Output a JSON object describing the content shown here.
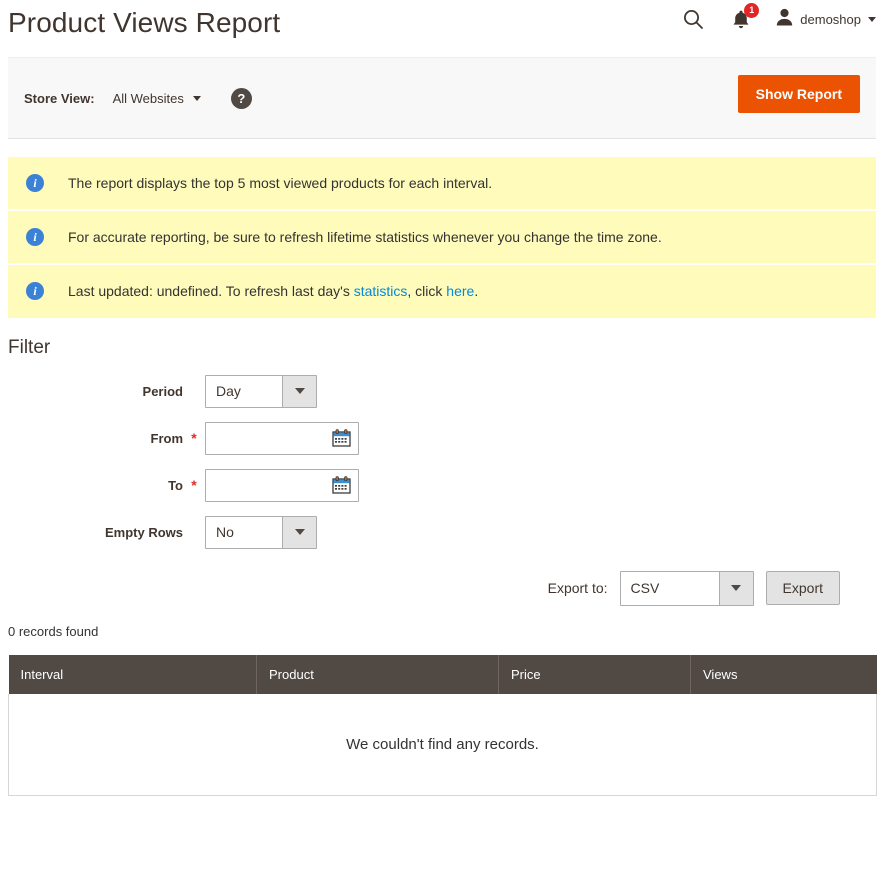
{
  "header": {
    "title": "Product Views Report",
    "search_icon": "search-icon",
    "notifications_icon": "bell-icon",
    "notifications_count": "1",
    "avatar_icon": "user-avatar-icon",
    "account_name": "demoshop",
    "account_caret": "chevron-down-icon"
  },
  "toolbar": {
    "store_view_label": "Store View:",
    "store_view_value": "All Websites",
    "help_icon_glyph": "?",
    "show_report_label": "Show Report"
  },
  "notices": [
    {
      "icon": "info-icon",
      "segments": [
        {
          "text": "The report displays the top 5 most viewed products for each interval.",
          "link": false
        }
      ]
    },
    {
      "icon": "info-icon",
      "segments": [
        {
          "text": "For accurate reporting, be sure to refresh lifetime statistics whenever you change the time zone.",
          "link": false
        }
      ]
    },
    {
      "icon": "info-icon",
      "segments": [
        {
          "text": "Last updated: undefined. To refresh last day's ",
          "link": false
        },
        {
          "text": "statistics",
          "link": true
        },
        {
          "text": ", click ",
          "link": false
        },
        {
          "text": "here",
          "link": true
        },
        {
          "text": ".",
          "link": false
        }
      ]
    }
  ],
  "filter": {
    "heading": "Filter",
    "fields": [
      {
        "label": "Period",
        "type": "select",
        "value": "Day",
        "required": false
      },
      {
        "label": "From",
        "type": "date",
        "value": "",
        "placeholder": "",
        "required": true
      },
      {
        "label": "To",
        "type": "date",
        "value": "",
        "placeholder": "",
        "required": true
      },
      {
        "label": "Empty Rows",
        "type": "select",
        "value": "No",
        "required": false
      }
    ],
    "required_marker": "*"
  },
  "export": {
    "label": "Export to:",
    "format": "CSV",
    "button_label": "Export"
  },
  "results": {
    "records_found": "0 records found",
    "columns": [
      "Interval",
      "Product",
      "Price",
      "Views"
    ],
    "rows": [],
    "empty_message": "We couldn't find any records."
  },
  "colors": {
    "accent_orange": "#eb5202",
    "notice_yellow": "#fffbbb",
    "table_header": "#514943",
    "link_blue": "#008bdb",
    "badge_red": "#e22626",
    "info_blue": "#3b82d6"
  }
}
